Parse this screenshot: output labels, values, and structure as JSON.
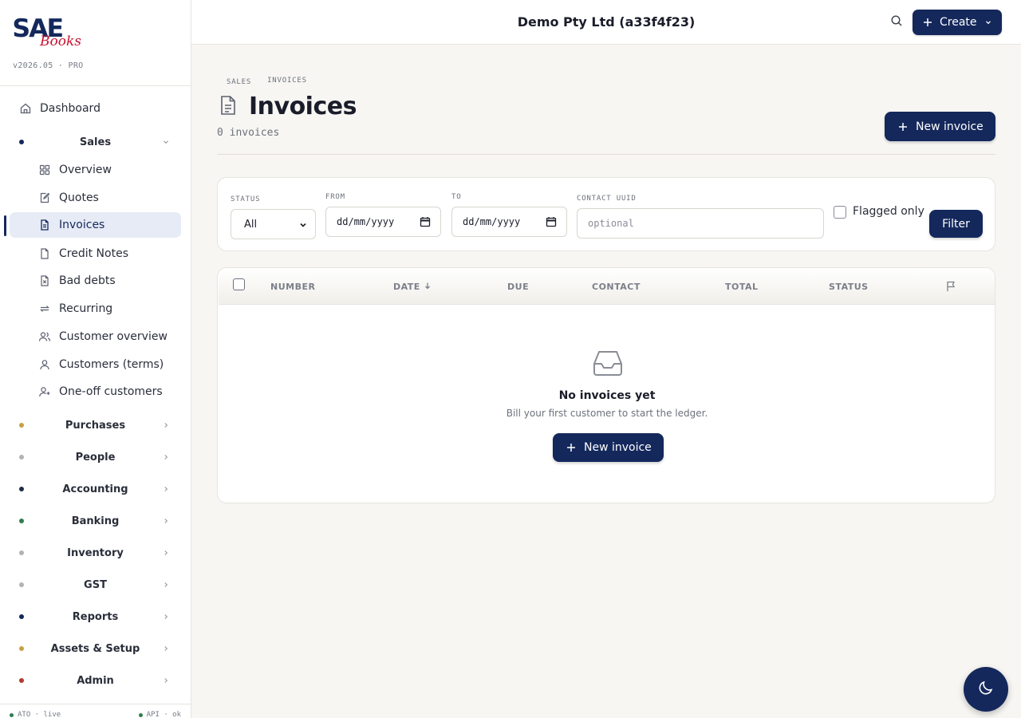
{
  "brand": {
    "logo_main": "SAE",
    "logo_sub": "Books",
    "version": "v2026.05 · PRO"
  },
  "sidebar": {
    "dashboard": "Dashboard",
    "sales_group": "Sales",
    "sales_items": [
      {
        "label": "Overview",
        "icon": "grid-icon"
      },
      {
        "label": "Quotes",
        "icon": "edit-doc-icon"
      },
      {
        "label": "Invoices",
        "icon": "document-icon",
        "active": true
      },
      {
        "label": "Credit Notes",
        "icon": "document-icon"
      },
      {
        "label": "Bad debts",
        "icon": "x-document-icon"
      },
      {
        "label": "Recurring",
        "icon": "repeat-icon"
      },
      {
        "label": "Customer overview",
        "icon": "users-icon"
      },
      {
        "label": "Customers (terms)",
        "icon": "user-icon"
      },
      {
        "label": "One-off customers",
        "icon": "user-plus-icon"
      }
    ],
    "groups": [
      {
        "label": "Purchases",
        "color": "#c9a040"
      },
      {
        "label": "People",
        "color": "#b3b3b3"
      },
      {
        "label": "Accounting",
        "color": "#1f2d4a"
      },
      {
        "label": "Banking",
        "color": "#2f7d4f"
      },
      {
        "label": "Inventory",
        "color": "#b3b3b3"
      },
      {
        "label": "GST",
        "color": "#b3b3b3"
      },
      {
        "label": "Reports",
        "color": "#14285c"
      },
      {
        "label": "Assets & Setup",
        "color": "#c9a040"
      },
      {
        "label": "Admin",
        "color": "#b23a2e"
      }
    ],
    "sales_dot_color": "#14285c",
    "footer_left": "ATO · live",
    "footer_right": "API · ok"
  },
  "topbar": {
    "company": "Demo Pty Ltd (a33f4f23)",
    "create_label": "Create"
  },
  "page": {
    "breadcrumb": [
      "SALES",
      "INVOICES"
    ],
    "title": "Invoices",
    "count": "0 invoices",
    "new_invoice_label": "New invoice"
  },
  "filters": {
    "status_label": "STATUS",
    "status_value": "All",
    "from_label": "FROM",
    "from_value": "dd/mm/yyyy",
    "to_label": "TO",
    "to_value": "dd/mm/yyyy",
    "contact_label": "CONTACT UUID",
    "contact_placeholder": "optional",
    "flagged_label": "Flagged only",
    "filter_button": "Filter"
  },
  "table": {
    "columns": [
      "NUMBER",
      "DATE",
      "DUE",
      "CONTACT",
      "TOTAL",
      "STATUS"
    ],
    "sorted_column": "DATE",
    "empty_title": "No invoices yet",
    "empty_subtitle": "Bill your first customer to start the ledger.",
    "empty_button": "New invoice"
  },
  "colors": {
    "accent": "#14285c",
    "logo_red": "#c8102e",
    "background": "#f7f6f3"
  }
}
